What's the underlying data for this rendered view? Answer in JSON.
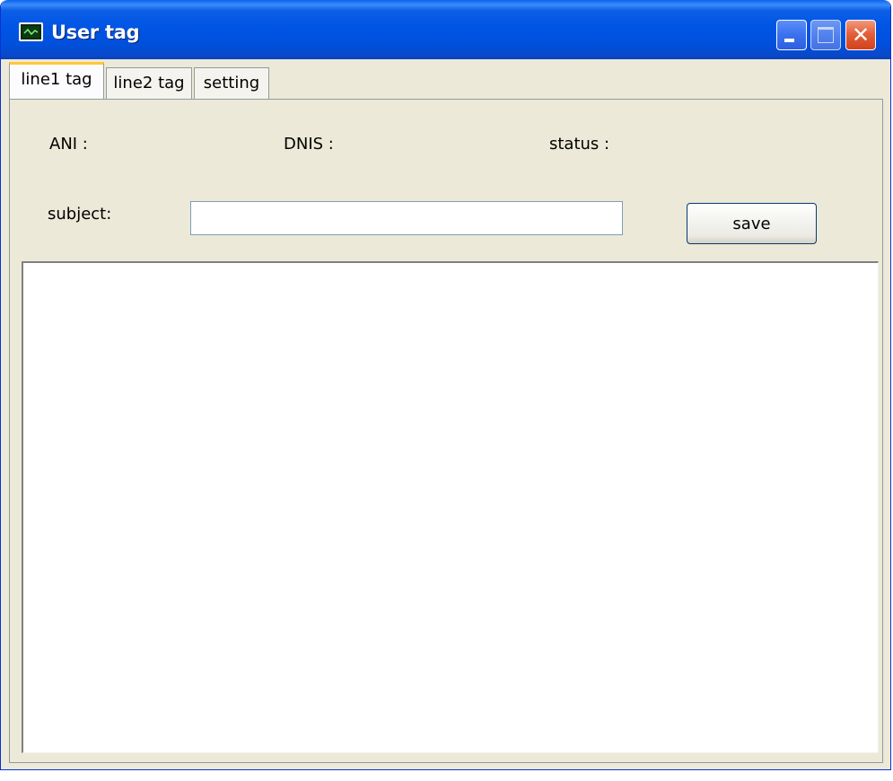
{
  "window": {
    "title": "User tag",
    "icon": "app-monitor-icon",
    "controls": {
      "minimize_icon": "minimize-icon",
      "maximize_icon": "maximize-icon",
      "close_icon": "close-icon",
      "close_glyph": "✕"
    }
  },
  "tabs": [
    {
      "label": "line1 tag",
      "active": true
    },
    {
      "label": "line2 tag",
      "active": false
    },
    {
      "label": "setting",
      "active": false
    }
  ],
  "panel": {
    "ani_label": "ANI   :",
    "dnis_label": "DNIS :",
    "status_label": "status    :",
    "subject_label": "subject:",
    "subject_value": "",
    "save_label": "save",
    "text_value": ""
  },
  "colors": {
    "titlebar": "#0055e5",
    "window_bg": "#ece9d8",
    "active_tab_accent": "#ffc83c",
    "close_button": "#e3603b"
  }
}
